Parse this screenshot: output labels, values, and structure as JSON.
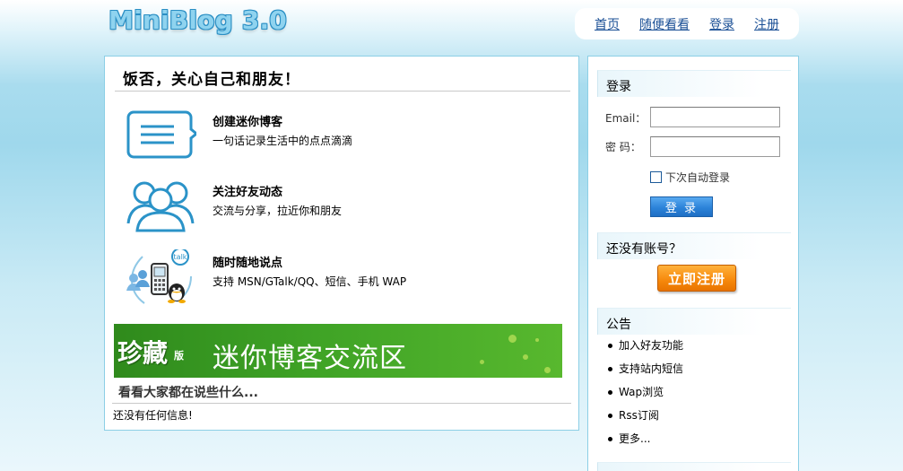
{
  "header": {
    "logo": "MiniBlog 3.0",
    "nav": [
      "首页",
      "随便看看",
      "登录",
      "注册"
    ]
  },
  "main": {
    "title": "饭否，关心自己和朋友！",
    "features": [
      {
        "icon": "chat-bubble-icon",
        "title": "创建迷你博客",
        "desc": "一句话记录生活中的点点滴滴"
      },
      {
        "icon": "friends-icon",
        "title": "关注好友动态",
        "desc": "交流与分享，拉近你和朋友"
      },
      {
        "icon": "mobile-im-icon",
        "title": "随时随地说点",
        "desc": "支持 MSN/GTalk/QQ、短信、手机 WAP"
      }
    ],
    "banner": {
      "main_text": "珍藏",
      "badge": "版",
      "secondary_text": "迷你博客交流区"
    },
    "see_title": "看看大家都在说些什么...",
    "empty_message": "还没有任何信息!"
  },
  "sidebar": {
    "login": {
      "heading": "登录",
      "email_label": "Email：",
      "password_label": "密 码：",
      "email_value": "",
      "password_value": "",
      "remember_label": "下次自动登录",
      "submit_label": "登 录"
    },
    "register": {
      "heading": "还没有账号？",
      "button_label": "立即注册"
    },
    "notice": {
      "heading": "公告",
      "items": [
        "加入好友功能",
        "支持站内短信",
        "Wap浏览",
        "Rss订阅",
        "更多..."
      ]
    }
  },
  "colors": {
    "accent_blue": "#1a4f95",
    "border_blue": "#8ccfe6",
    "register_orange": "#f6880b",
    "banner_green": "#3fa326"
  }
}
